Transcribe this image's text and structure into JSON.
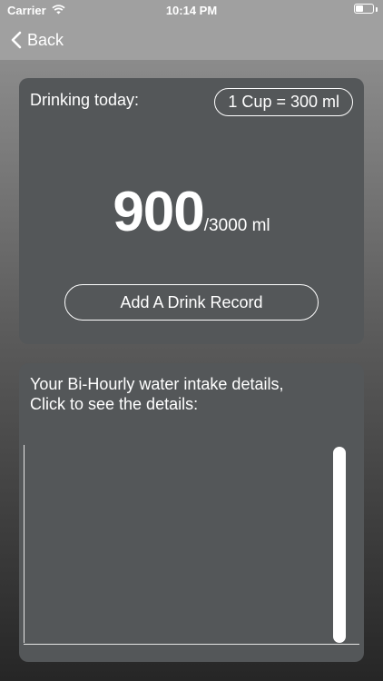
{
  "status_bar": {
    "carrier": "Carrier",
    "time": "10:14 PM",
    "battery_level": 0.45
  },
  "nav": {
    "back_label": "Back"
  },
  "today_card": {
    "label": "Drinking today:",
    "cup_setting": "1 Cup = 300 ml",
    "intake_value": "900",
    "intake_goal": "/3000 ml",
    "add_button_label": "Add A Drink Record"
  },
  "details_card": {
    "line1": "Your Bi-Hourly water intake details,",
    "line2": "Click to see the details:"
  },
  "colors": {
    "card": "#545759",
    "header": "#a0a0a0",
    "text": "#ffffff"
  },
  "icons": {
    "wifi": "wifi-icon",
    "battery": "battery-icon",
    "back": "chevron-left-icon"
  }
}
